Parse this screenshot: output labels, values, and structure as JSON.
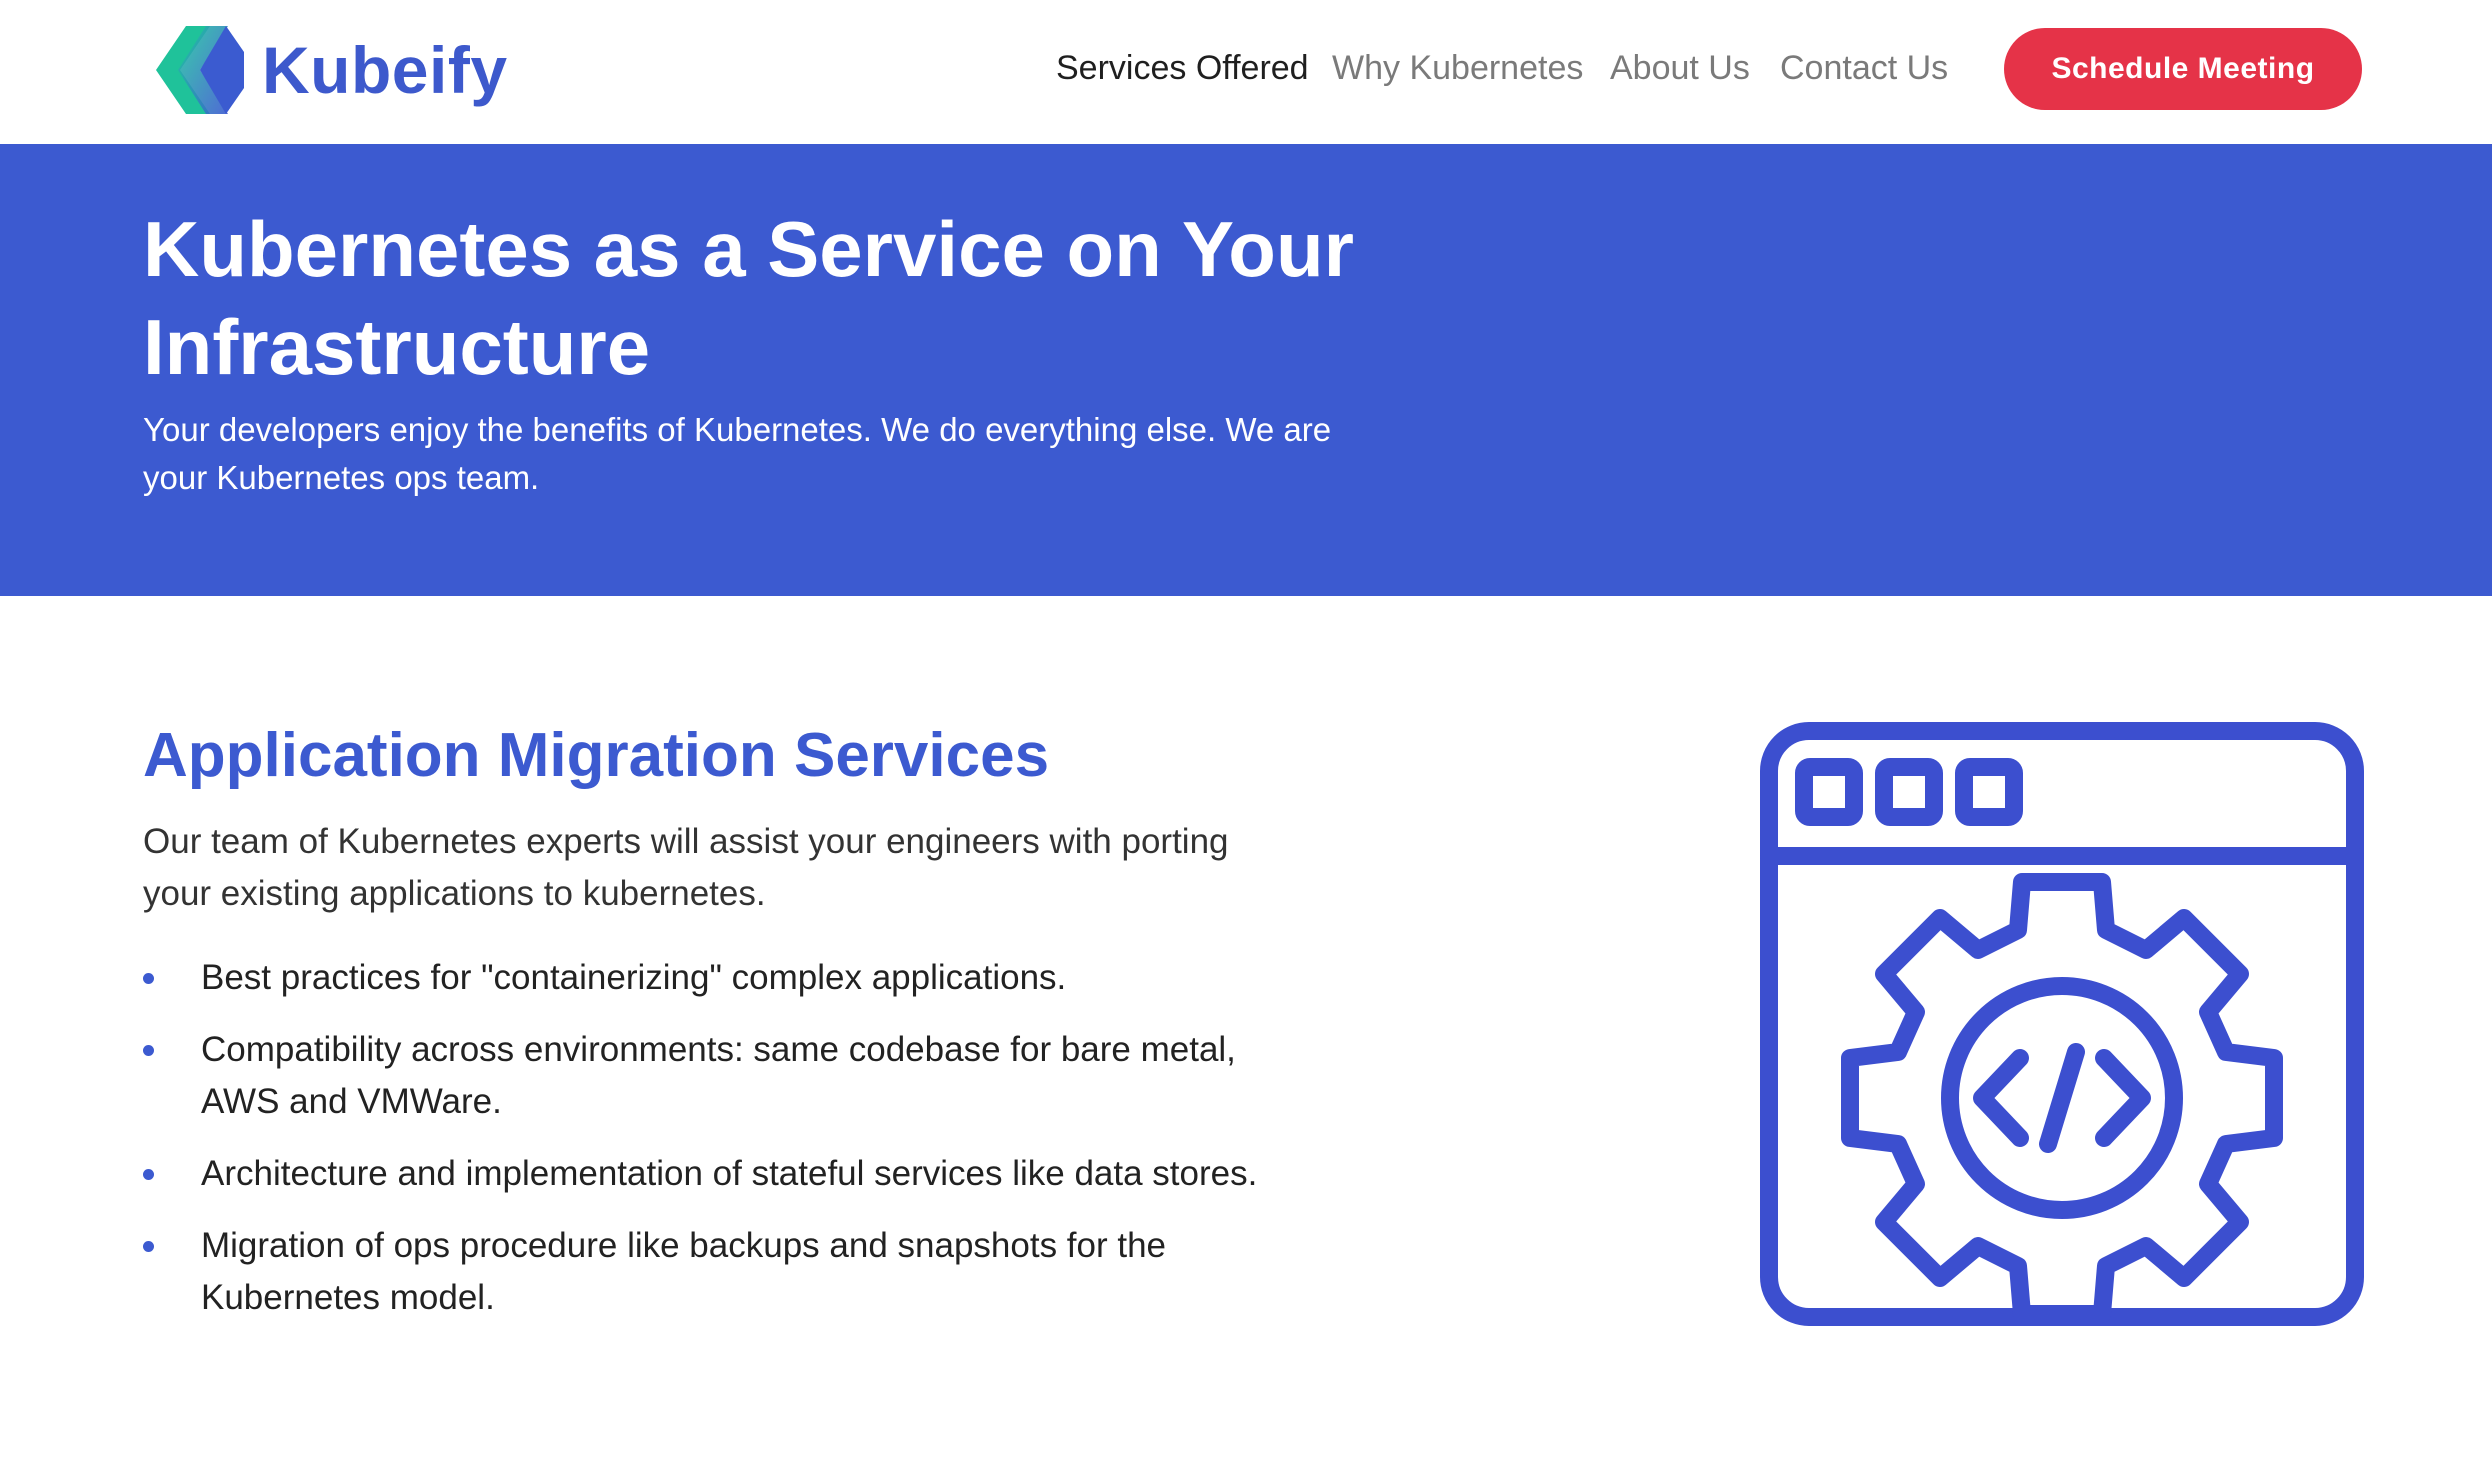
{
  "header": {
    "brand_name": "Kubeify",
    "logo_icon": "kubeify-logo-icon",
    "nav": [
      {
        "label": "Services Offered",
        "active": true
      },
      {
        "label": "Why Kubernetes",
        "active": false
      },
      {
        "label": "About Us",
        "active": false
      },
      {
        "label": "Contact Us",
        "active": false
      }
    ],
    "cta_label": "Schedule Meeting"
  },
  "hero": {
    "title": "Kubernetes as a Service on Your Infrastructure",
    "subtitle": "Your developers enjoy the benefits of Kubernetes. We do everything else. We are your Kubernetes ops team."
  },
  "section": {
    "title": "Application Migration Services",
    "description": "Our team of Kubernetes experts will assist your engineers with porting your existing applications to kubernetes.",
    "bullets": [
      "Best practices for \"containerizing\" complex applications.",
      "Compatibility across environments: same codebase for bare metal, AWS and VMWare.",
      "Architecture and implementation of stateful services like data stores.",
      "Migration of ops procedure like backups and snapshots for the Kubernetes model."
    ],
    "illustration_icon": "browser-gear-code-icon"
  },
  "colors": {
    "brand_blue": "#3c5ad0",
    "cta_red": "#e53348",
    "logo_teal": "#1fc29a"
  }
}
